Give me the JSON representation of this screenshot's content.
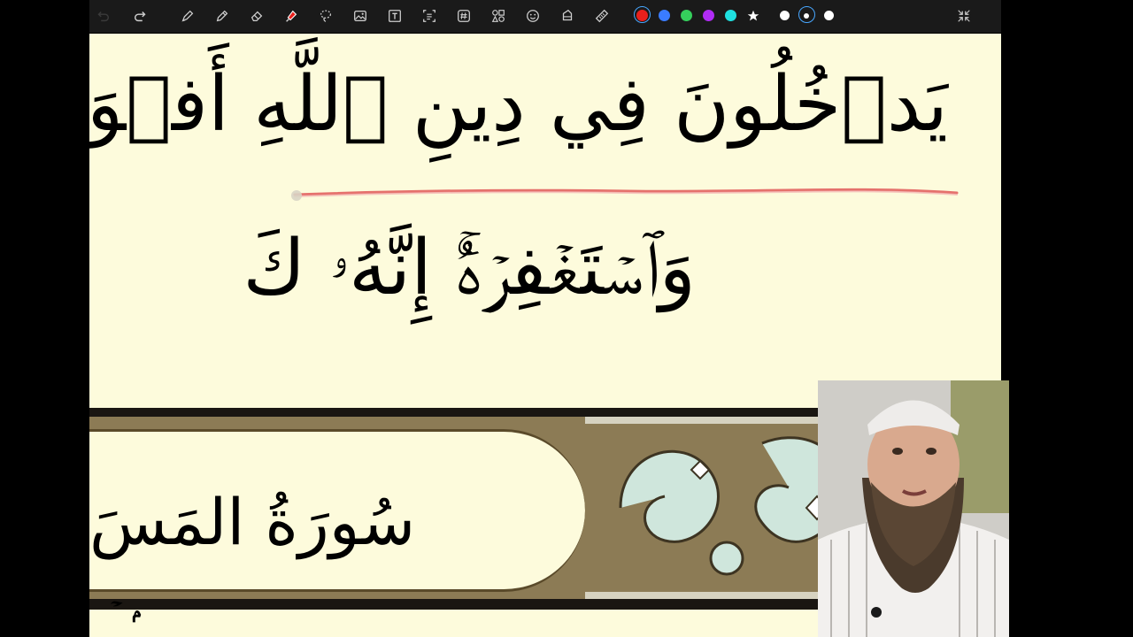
{
  "toolbar": {
    "tools": [
      "undo-icon",
      "redo-icon",
      "pen-icon",
      "pencil-icon",
      "eraser-icon",
      "highlighter-icon",
      "lasso-icon",
      "image-icon",
      "text-icon",
      "scan-text-icon",
      "hashtag-icon",
      "shapes-icon",
      "sticker-icon",
      "tape-icon",
      "ruler-icon"
    ],
    "colors": [
      "#e8201c",
      "#3a7cff",
      "#35d05c",
      "#b12cf5",
      "#1fe0e0"
    ],
    "selected_color": "#e8201c",
    "sizes": [
      "small",
      "medium",
      "large"
    ],
    "selected_size": "medium"
  },
  "page": {
    "line1": "يَدۡخُلُونَ فِي دِينِ ٱللَّهِ أَفۡوَاجٗا",
    "line2": "وَٱسۡتَغۡفِرۡهُۚ إِنَّهُۥ كَ",
    "sura_title": "سُورَةُ المَسَ",
    "line3": "ۢ ۡ"
  }
}
